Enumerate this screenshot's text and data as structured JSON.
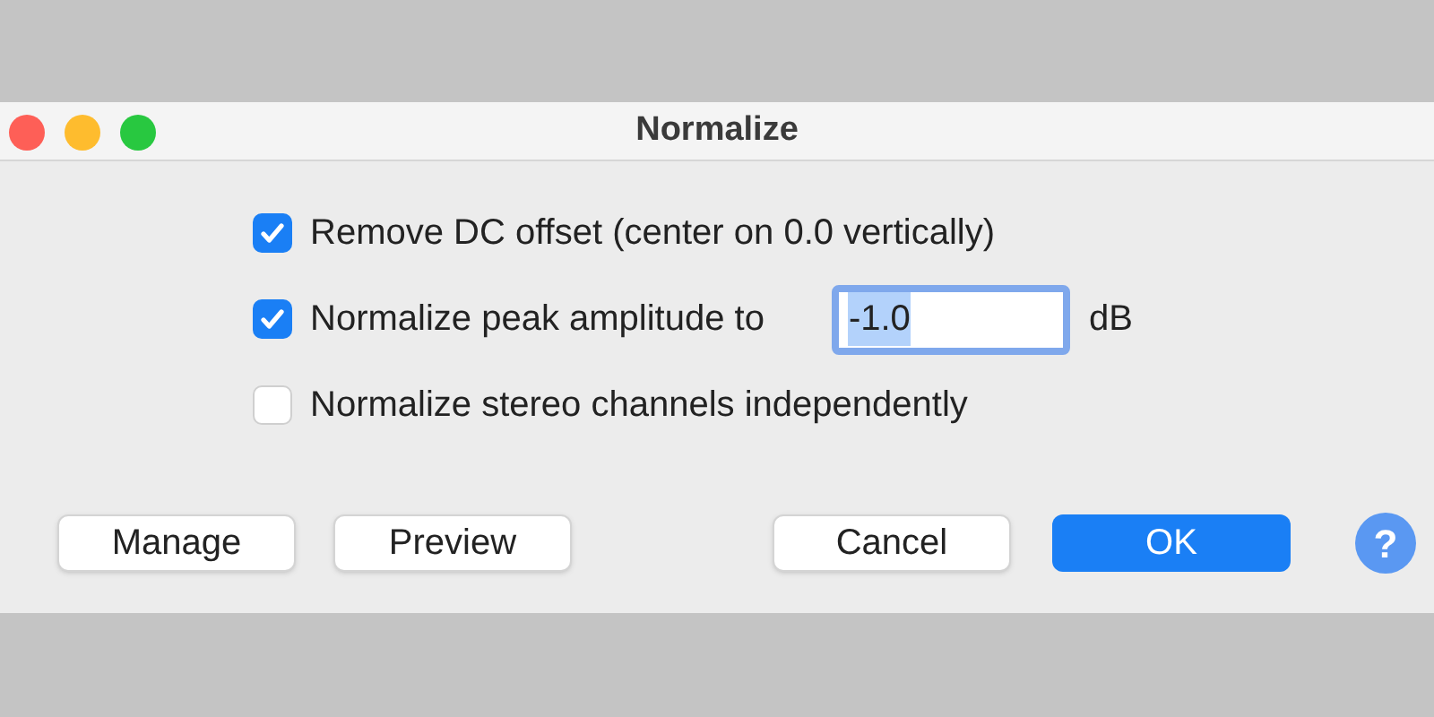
{
  "window": {
    "title": "Normalize"
  },
  "options": [
    {
      "label": "Remove DC offset (center on 0.0 vertically)",
      "checked": true
    },
    {
      "label": "Normalize peak amplitude to",
      "checked": true,
      "field": {
        "value": "-1.0",
        "focused": true,
        "unit": "dB"
      }
    },
    {
      "label": "Normalize stereo channels independently",
      "checked": false
    }
  ],
  "buttons": [
    {
      "label": "Manage",
      "kind": "normal"
    },
    {
      "label": "Preview",
      "kind": "normal"
    },
    {
      "label": "Cancel",
      "kind": "normal"
    },
    {
      "label": "OK",
      "kind": "default"
    },
    {
      "label": "?",
      "kind": "help"
    }
  ]
}
